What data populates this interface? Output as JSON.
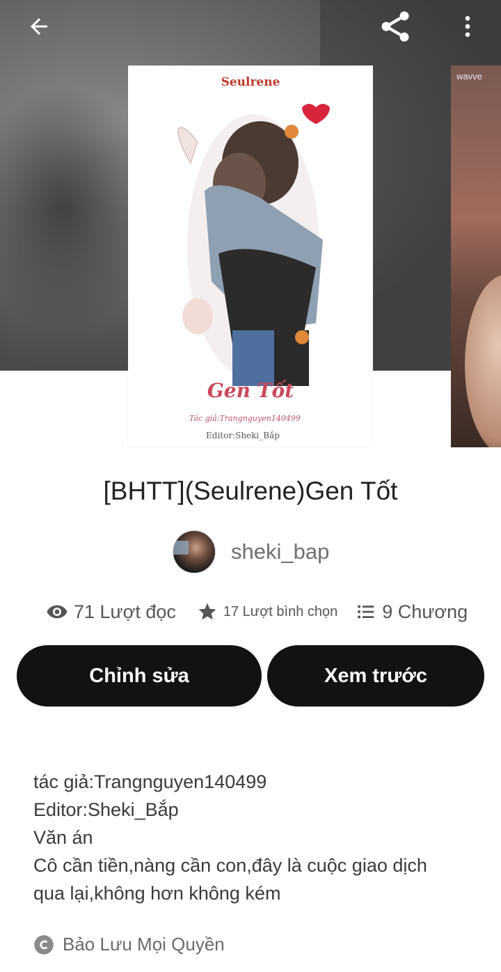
{
  "story": {
    "title": "[BHTT](Seulrene)Gen Tốt",
    "author": "sheki_bap",
    "stats": {
      "reads": "71 Lượt đọc",
      "votes": "17 Lượt bình chọn",
      "parts": "9 Chương"
    },
    "buttons": {
      "edit": "Chỉnh sửa",
      "preview": "Xem trước"
    },
    "description": [
      "tác giả:Trangnguyen140499",
      "Editor:Sheki_Bắp",
      "Văn án",
      "Cô cần tiền,nàng cần con,đây là cuộc giao dịch",
      "qua lại,không hơn không kém"
    ],
    "copyright": "Bảo Lưu Mọi Quyền"
  },
  "cover": {
    "brand": "Seulrene",
    "title": "Gen Tốt",
    "author_line": "Tác giả:Trangnguyen140499",
    "editor_line": "Editor:Sheki_Bắp"
  },
  "peek_cover": {
    "label": "wavve"
  },
  "icons": [
    "back-arrow-icon",
    "share-icon",
    "more-vertical-icon",
    "eye-icon",
    "star-icon",
    "list-icon",
    "copyright-icon"
  ],
  "colors": {
    "button_bg": "#121212",
    "button_text": "#ffffff",
    "title_text": "#222222",
    "muted_text": "#6f6f6f"
  }
}
